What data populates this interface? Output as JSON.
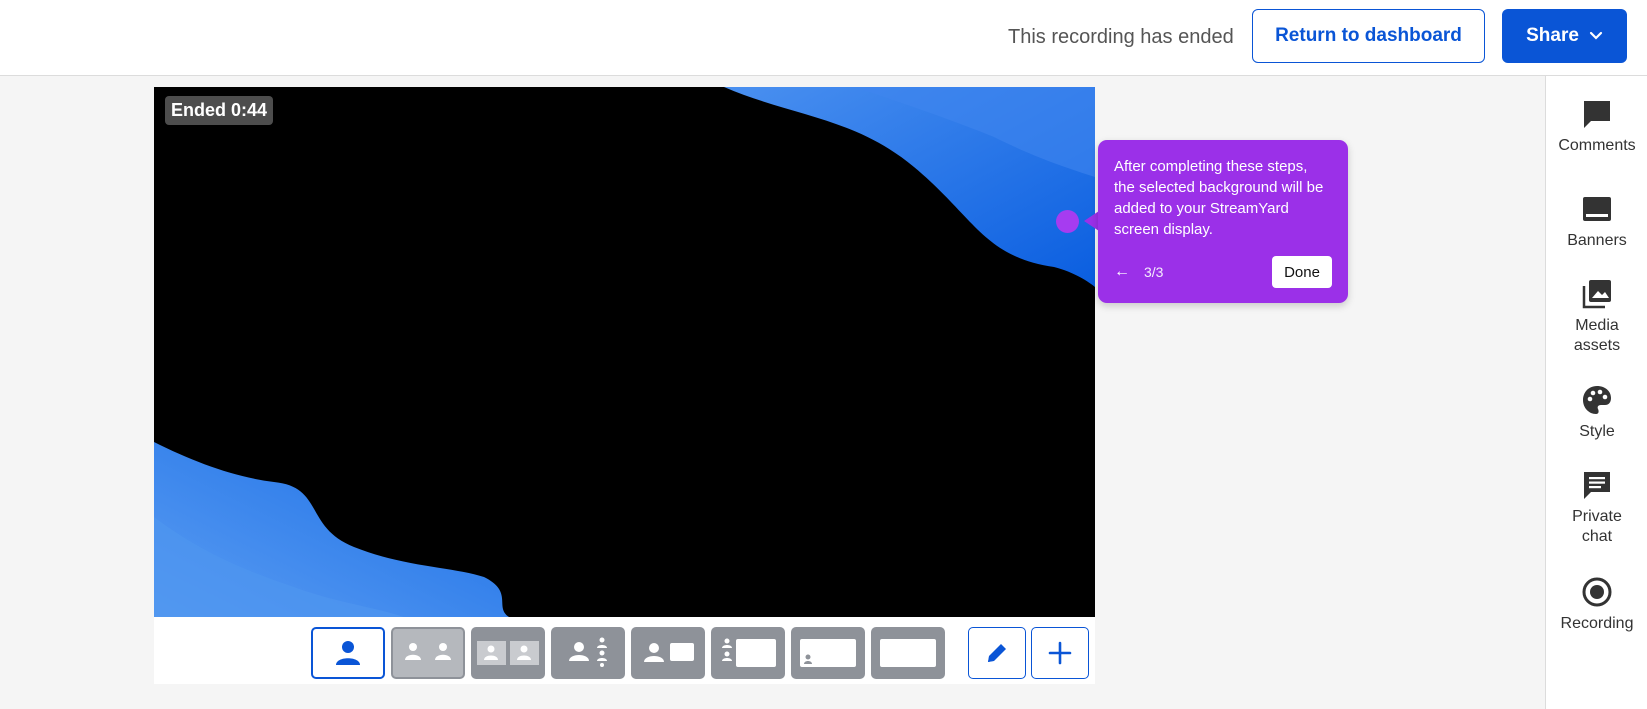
{
  "header": {
    "status": "This recording has ended",
    "return_label": "Return to dashboard",
    "share_label": "Share"
  },
  "stage": {
    "ended_badge": "Ended 0:44"
  },
  "tooltip": {
    "text": "After completing these steps, the selected background will be added to your StreamYard screen display.",
    "step": "3/3",
    "done_label": "Done"
  },
  "sidebar": {
    "comments": "Comments",
    "banners": "Banners",
    "media_assets": "Media assets",
    "style": "Style",
    "private_chat": "Private chat",
    "recording": "Recording"
  },
  "colors": {
    "accent": "#0a55d6",
    "tooltip": "#9b30e8",
    "wave": "#1a6ee6"
  }
}
